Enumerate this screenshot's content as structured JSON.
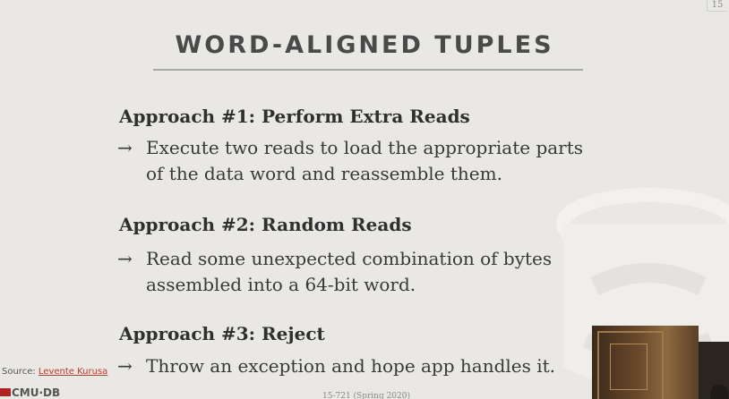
{
  "slide": {
    "number": "15",
    "title": "WORD-ALIGNED TUPLES",
    "approaches": [
      {
        "heading": "Approach #1: Perform Extra Reads",
        "arrow": "→",
        "text_line1": "Execute two reads to load the appropriate parts",
        "text_line2": "of the data word and reassemble them."
      },
      {
        "heading": "Approach #2: Random Reads",
        "arrow": "→",
        "text_line1": "Read some unexpected combination of bytes",
        "text_line2": "assembled into a 64-bit word."
      },
      {
        "heading": "Approach #3: Reject",
        "arrow": "→",
        "text_line1": "Throw an exception and hope app handles it.",
        "text_line2": ""
      }
    ],
    "source_label": "Source:",
    "source_author": "Levente Kurusa",
    "logo_text": "CMU·DB",
    "footer_course": "15-721 (Spring 2020)"
  },
  "colors": {
    "background": "#e9e8e4",
    "accent_link": "#c0392b",
    "logo_red": "#b22222"
  }
}
